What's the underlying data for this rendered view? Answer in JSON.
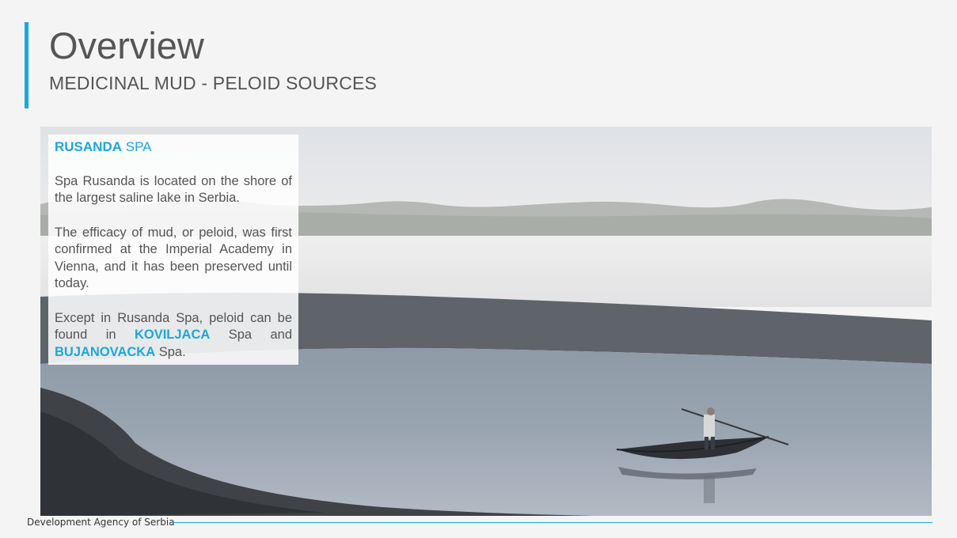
{
  "header": {
    "title": "Overview",
    "subtitle": "MEDICINAL MUD - PELOID SOURCES"
  },
  "card": {
    "heading_bold": "RUSANDA",
    "heading_light": "SPA",
    "paragraph1": "Spa Rusanda is located on the shore of the largest saline lake in Serbia.",
    "paragraph2": "The efficacy of mud, or peloid, was first confirmed at the Imperial Academy in Vienna, and it has been preserved until today.",
    "paragraph3_part1": "Except in Rusanda Spa, peloid can be found in ",
    "paragraph3_highlight1": "KOVILJACA",
    "paragraph3_part2": " Spa and ",
    "paragraph3_highlight2": "BUJANOVACKA",
    "paragraph3_part3": " Spa."
  },
  "photo": {
    "subject": "lake-with-boatman-image"
  },
  "footer": {
    "text": "Development Agency of Serbia"
  },
  "colors": {
    "accent": "#1aa7de",
    "text": "#555555",
    "background": "#f4f4f4"
  }
}
